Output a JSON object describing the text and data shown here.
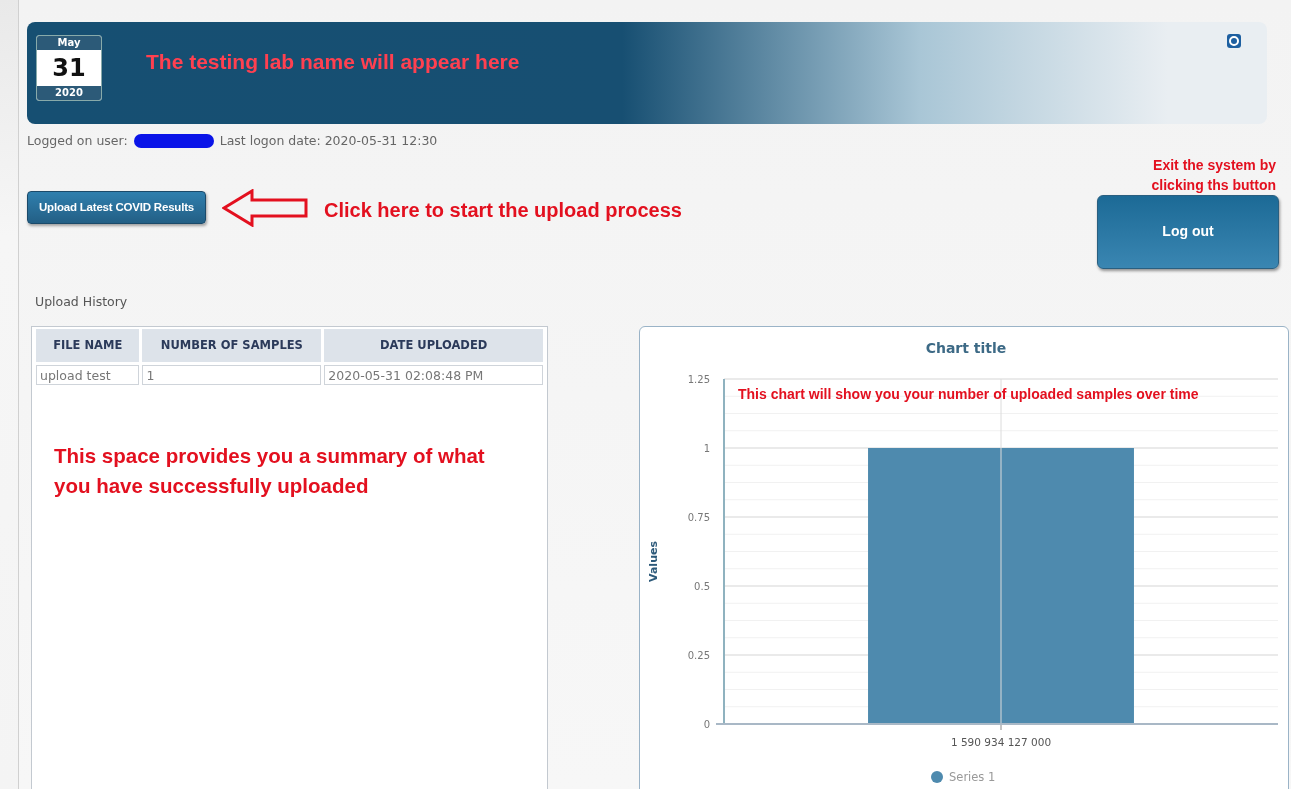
{
  "header": {
    "calendar": {
      "month": "May",
      "day": "31",
      "year": "2020"
    },
    "annotation": "The testing lab name will appear here"
  },
  "user_line": {
    "label": "Logged on user:",
    "last_logon": "Last logon date: 2020-05-31 12:30"
  },
  "upload": {
    "button": "Upload Latest COVID Results",
    "annotation": "Click here to start the upload process"
  },
  "logout": {
    "annotation": "Exit the system by clicking ths button",
    "button": "Log out"
  },
  "history": {
    "title": "Upload History",
    "columns": [
      "FILE NAME",
      "NUMBER OF SAMPLES",
      "DATE UPLOADED"
    ],
    "rows": [
      [
        "upload test",
        "1",
        "2020-05-31 02:08:48 PM"
      ]
    ],
    "annotation": "This space provides you a summary of what you have successfully uploaded"
  },
  "chart": {
    "annotation": "This chart will show you your number of uploaded samples over time",
    "chart_data": {
      "type": "bar",
      "title": "Chart title",
      "ylabel": "Values",
      "categories": [
        "1 590 934 127 000"
      ],
      "series": [
        {
          "name": "Series 1",
          "color": "#4e8aae",
          "values": [
            1
          ]
        }
      ],
      "ylim": [
        0,
        1.25
      ],
      "grid": true,
      "yticks": [
        0,
        0.25,
        0.5,
        0.75,
        1,
        1.25
      ]
    }
  }
}
